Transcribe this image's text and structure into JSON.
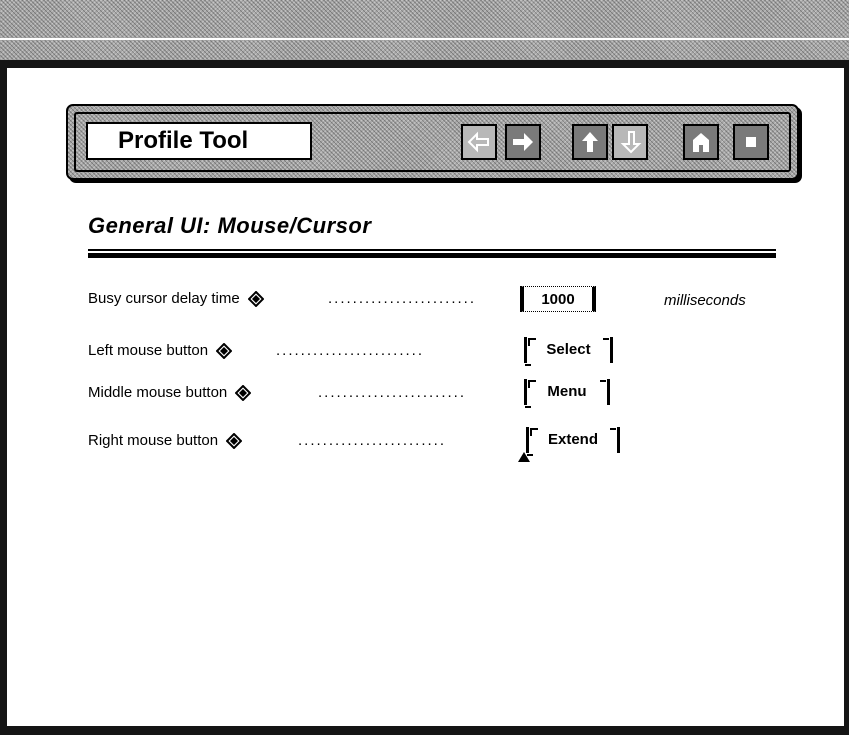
{
  "window": {
    "title": "Profile Tool"
  },
  "toolbar": {
    "buttons": [
      {
        "name": "back",
        "icon": "arrow-left-icon",
        "enabled": false
      },
      {
        "name": "forward",
        "icon": "arrow-right-icon",
        "enabled": true
      },
      {
        "name": "up",
        "icon": "arrow-up-icon",
        "enabled": true
      },
      {
        "name": "down",
        "icon": "arrow-down-icon",
        "enabled": false
      },
      {
        "name": "home",
        "icon": "home-icon",
        "enabled": true
      },
      {
        "name": "stop",
        "icon": "stop-icon",
        "enabled": true
      }
    ]
  },
  "section": {
    "title": "General UI:  Mouse/Cursor"
  },
  "settings": [
    {
      "label": "Busy cursor delay time",
      "icon": "diamond-icon",
      "value": "1000",
      "field_type": "text",
      "units": "milliseconds"
    },
    {
      "label": "Left mouse button",
      "icon": "diamond-icon",
      "value": "Select",
      "field_type": "option"
    },
    {
      "label": "Middle mouse button",
      "icon": "diamond-icon",
      "value": "Menu",
      "field_type": "option"
    },
    {
      "label": "Right mouse button",
      "icon": "diamond-icon",
      "value": "Extend",
      "field_type": "option"
    }
  ],
  "leader": "........................",
  "colors": {
    "frame": "#151515",
    "background": "#ffffff",
    "dither": "#a8a8a8"
  }
}
